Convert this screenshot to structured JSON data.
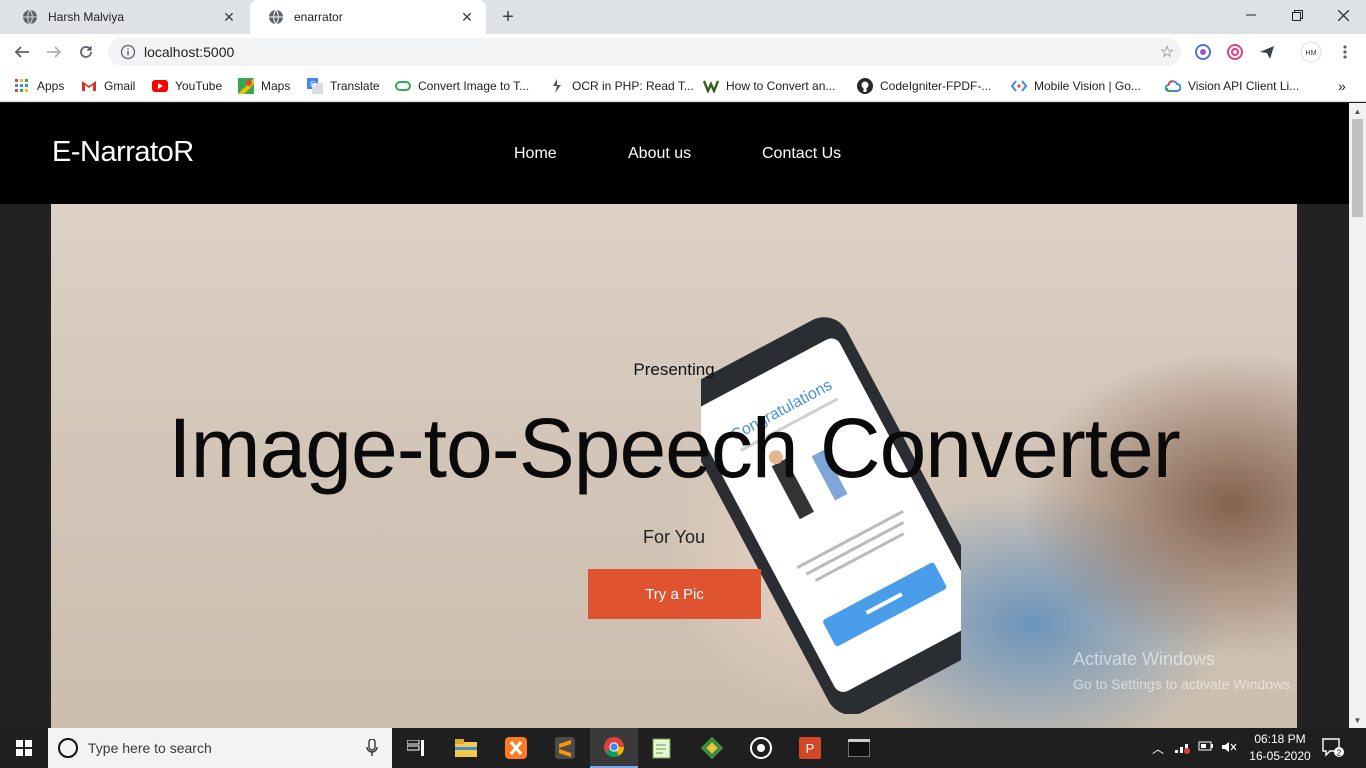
{
  "browser": {
    "tabs": [
      {
        "title": "Harsh Malviya",
        "active": false
      },
      {
        "title": "enarrator",
        "active": true
      }
    ],
    "url": "localhost:5000",
    "bookmarks": [
      {
        "label": "Apps",
        "icon": "apps-grid-icon"
      },
      {
        "label": "Gmail",
        "icon": "gmail-icon"
      },
      {
        "label": "YouTube",
        "icon": "youtube-icon"
      },
      {
        "label": "Maps",
        "icon": "maps-icon"
      },
      {
        "label": "Translate",
        "icon": "translate-icon"
      },
      {
        "label": "Convert Image to T...",
        "icon": "link-icon"
      },
      {
        "label": "OCR in PHP: Read T...",
        "icon": "link-icon"
      },
      {
        "label": "How to Convert an...",
        "icon": "link-icon"
      },
      {
        "label": "CodeIgniter-FPDF-...",
        "icon": "github-icon"
      },
      {
        "label": "Mobile Vision  |  Go...",
        "icon": "link-icon"
      },
      {
        "label": "Vision API Client Li...",
        "icon": "google-cloud-icon"
      }
    ],
    "more_bookmarks": "»"
  },
  "site": {
    "brand": "E-NarratoR",
    "nav": {
      "home": "Home",
      "about": "About us",
      "contact": "Contact Us"
    },
    "hero": {
      "presenting": "Presenting",
      "headline": "Image-to-Speech Converter",
      "subline": "For You",
      "cta": "Try a Pic"
    },
    "watermark": {
      "line1": "Activate Windows",
      "line2": "Go to Settings to activate Windows."
    }
  },
  "taskbar": {
    "search_placeholder": "Type here to search",
    "time": "06:18 PM",
    "date": "16-05-2020",
    "notification_count": "2"
  },
  "colors": {
    "cta": "#e05330",
    "site_nav": "#000000",
    "taskbar": "#1f1f1f"
  }
}
